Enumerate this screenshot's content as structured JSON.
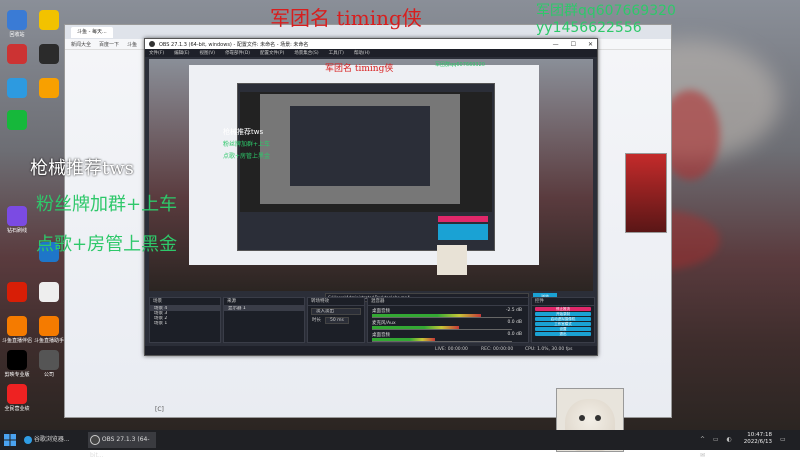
{
  "overlay": {
    "title": "军团名  timing侠",
    "qq": "军团群qq607669320",
    "yy": "yy1456622556",
    "line1": "枪械推荐tws",
    "line2": "粉丝牌加群+上车",
    "line3": "点歌+房管上黑金"
  },
  "desktop_icons": [
    {
      "label": "回收站",
      "color": "#3a7bd5",
      "icon": "recycle-icon"
    },
    {
      "label": "",
      "color": "#f2c200",
      "icon": "game-icon"
    },
    {
      "label": "",
      "color": "#c33",
      "icon": "app-icon"
    },
    {
      "label": "",
      "color": "#2b2b2b",
      "icon": "app-icon"
    },
    {
      "label": "",
      "color": "#2d9ae0",
      "icon": "qq-icon"
    },
    {
      "label": "",
      "color": "#f8a000",
      "icon": "folder-icon"
    },
    {
      "label": "",
      "color": "#16b83b",
      "icon": "app-icon"
    },
    {
      "label": "钻石刷线",
      "color": "#7b4be3",
      "icon": "app-icon"
    },
    {
      "label": "",
      "color": "#1e76c9",
      "icon": "app-icon"
    },
    {
      "label": "",
      "color": "#d81e06",
      "icon": "netease-icon"
    },
    {
      "label": "",
      "color": "#eee",
      "icon": "file-icon"
    },
    {
      "label": "斗鱼直播伴侣",
      "color": "#f57b00",
      "icon": "douyu-icon"
    },
    {
      "label": "斗鱼直播助手",
      "color": "#f57b00",
      "icon": "douyu-icon"
    },
    {
      "label": "剪映专业版",
      "color": "#000",
      "icon": "capcut-icon"
    },
    {
      "label": "公司",
      "color": "#555",
      "icon": "folder-icon"
    },
    {
      "label": "全民营业绩",
      "color": "#e22",
      "icon": "app-icon"
    }
  ],
  "browser": {
    "tab": "斗鱼 - 每天...",
    "bookmarks": [
      "新闻大全",
      "百度一下",
      "斗鱼"
    ],
    "bottom_text": "[C]"
  },
  "obs": {
    "window_title": "OBS 27.1.3 (64-bit, windows) - 配置文件: 未命名 - 场景: 未命名",
    "menus": [
      "文件(F)",
      "编辑(E)",
      "视图(V)",
      "停靠部件(D)",
      "配置文件(P)",
      "场景集合(S)",
      "工具(T)",
      "帮助(H)"
    ],
    "file_path": "C:\\Users\\Administrator\\Desktop\\obs.mp4",
    "file_btn": "浏览",
    "scene_dock": {
      "title": "场景",
      "items": [
        "场景 4",
        "场景 3",
        "场景 2",
        "场景 1"
      ]
    },
    "source_dock": {
      "title": "来源",
      "items": [
        "显示器 1"
      ]
    },
    "transition_dock": {
      "title": "转场特效",
      "value": "淡入淡出",
      "duration_label": "时长",
      "duration": "50 ms"
    },
    "mixer_dock": {
      "title": "混音器",
      "channels": [
        {
          "name": "桌面音频",
          "db": "-2.5 dB",
          "level": 0.78
        },
        {
          "name": "麦克风/Aux",
          "db": "0.0 dB",
          "level": 0.62
        },
        {
          "name": "桌面音频",
          "db": "0.0 dB",
          "level": 0.45
        }
      ]
    },
    "controls": {
      "title": "控件",
      "buttons": [
        "停止推流",
        "开始录制",
        "启动虚拟摄像机",
        "工作室模式",
        "设置",
        "退出"
      ]
    },
    "status": {
      "live": "LIVE: 00:00:00",
      "rec": "REC: 00:00:00",
      "cpu": "CPU: 1.0%, 30.00 fps"
    }
  },
  "taskbar": {
    "items": [
      "谷歌浏览器...",
      "OBS 27.1.3 (64-bit..."
    ],
    "time": "10:47:18",
    "date": "2022/6/13"
  },
  "colors": {
    "obs_bg": "#2b2e38",
    "accent_pink": "#e0286a",
    "overlay_red": "#d81e1e",
    "overlay_green": "#2ec86a"
  }
}
